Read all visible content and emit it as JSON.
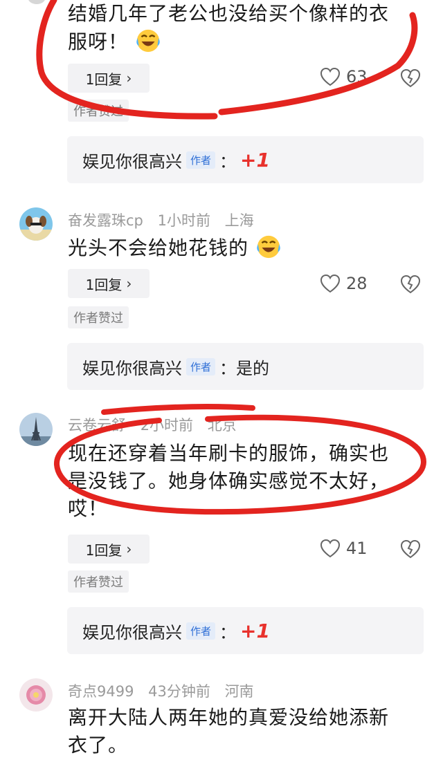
{
  "comments": [
    {
      "text_lines": [
        "结婚几年了老公也没给买个像样的衣",
        "服呀！"
      ],
      "emoji": "laughing-crying-emoji",
      "reply_label": "1回复",
      "likes": "63",
      "liked_label": "作者赞过",
      "author_reply": {
        "name": "娱见你很高兴",
        "tag": "作者",
        "colon": "：",
        "text": "+1"
      }
    },
    {
      "username": "奋发露珠cp",
      "time": "1小时前",
      "location": "上海",
      "text_lines": [
        "光头不会给她花钱的"
      ],
      "emoji": "laughing-crying-emoji",
      "reply_label": "1回复",
      "likes": "28",
      "liked_label": "作者赞过",
      "author_reply": {
        "name": "娱见你很高兴",
        "tag": "作者",
        "colon": "：",
        "text": "是的"
      }
    },
    {
      "username": "云卷云舒",
      "time": "2小时前",
      "location": "北京",
      "text_lines": [
        "现在还穿着当年刷卡的服饰，确实也",
        "是没钱了。她身体确实感觉不太好，",
        "哎！"
      ],
      "reply_label": "1回复",
      "likes": "41",
      "liked_label": "作者赞过",
      "author_reply": {
        "name": "娱见你很高兴",
        "tag": "作者",
        "colon": "：",
        "text": "+1"
      }
    },
    {
      "username": "奇点9499",
      "time": "43分钟前",
      "location": "河南",
      "text_lines": [
        "离开大陆人两年她的真爱没给她添新",
        "衣了。"
      ]
    }
  ],
  "icons": {
    "reply_chevron": "chevron-right-icon",
    "like": "heart-outline-icon",
    "dislike": "broken-heart-icon"
  },
  "colors": {
    "annotation_red": "#e3241f",
    "plus_one_red": "#e8312c",
    "author_tag_blue": "#2f6fd6"
  }
}
